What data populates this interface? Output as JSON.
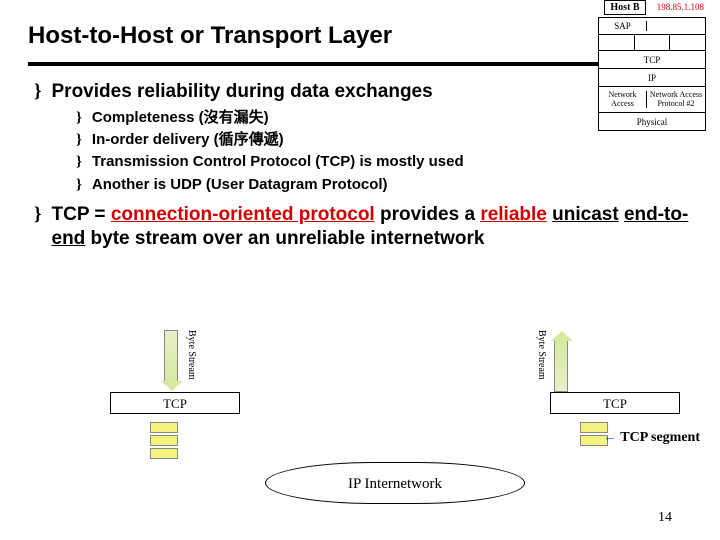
{
  "title": "Host-to-Host or Transport Layer",
  "bullets": [
    {
      "text": "Provides reliability during data exchanges",
      "sub": [
        "Completeness (沒有漏失)",
        "In-order delivery (循序傳遞)",
        "Transmission Control Protocol (TCP) is mostly used",
        "Another is UDP (User Datagram Protocol)"
      ]
    }
  ],
  "tcp_sentence": {
    "prefix": "TCP = ",
    "red1": "connection-oriented protocol",
    "mid1": " provides a ",
    "red2": "reliable",
    "mid2": " ",
    "und1": "unicast",
    "mid3": " ",
    "und2": "end-to-end",
    "mid4": " byte stream over an unreliable internetwork"
  },
  "stack": {
    "host_label": "Host B",
    "ip_addr": "198.85.1.108",
    "rows": {
      "app_left": "SAP",
      "app_right": "",
      "tcp": "TCP",
      "ip": "IP",
      "na_left": "Network Access",
      "na_right": "Network Access Protocol #2",
      "phys": "Physical"
    }
  },
  "diagram": {
    "byte_stream_label": "Byte Stream",
    "tcp_label": "TCP",
    "cloud_label": "IP Internetwork",
    "segment_note_arrow": "←",
    "segment_note_text": " TCP segment"
  },
  "page_number": "14",
  "bullet_glyph": "}"
}
